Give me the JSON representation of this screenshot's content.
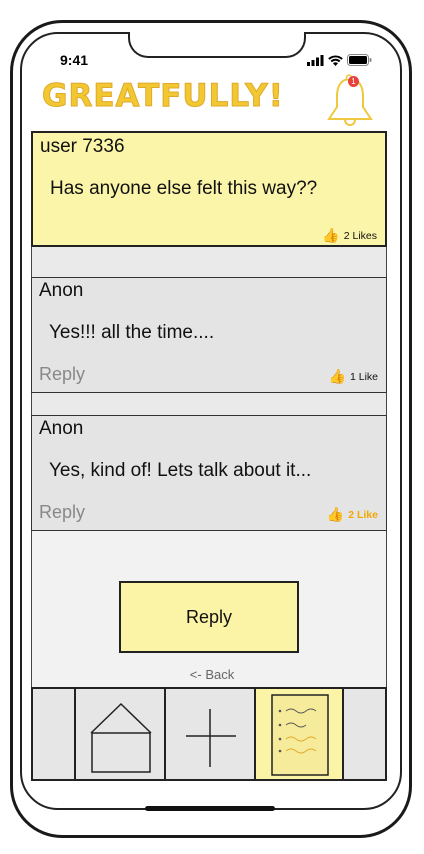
{
  "status_bar": {
    "time": "9:41"
  },
  "header": {
    "app_title": "GREATFULLY!",
    "notification_count": "1",
    "brand_color": "#f2c832"
  },
  "post": {
    "author": "user 7336",
    "message": "Has anyone else felt this way??",
    "likes": "2 Likes"
  },
  "replies": [
    {
      "author": "Anon",
      "message": "Yes!!! all the time....",
      "reply_label": "Reply",
      "likes": "1 Like",
      "liked": false
    },
    {
      "author": "Anon",
      "message": "Yes, kind of! Lets talk about it...",
      "reply_label": "Reply",
      "likes": "2 Like",
      "liked": true
    }
  ],
  "actions": {
    "reply_button": "Reply",
    "back_link": "<- Back"
  },
  "tabbar": {
    "tabs": [
      "home-icon",
      "plus-icon",
      "notes-icon"
    ],
    "active_tab": "notes-icon"
  },
  "colors": {
    "post_bg": "#fbf5a9",
    "card_bg": "#e4e4e4",
    "liked": "#f2a800"
  }
}
